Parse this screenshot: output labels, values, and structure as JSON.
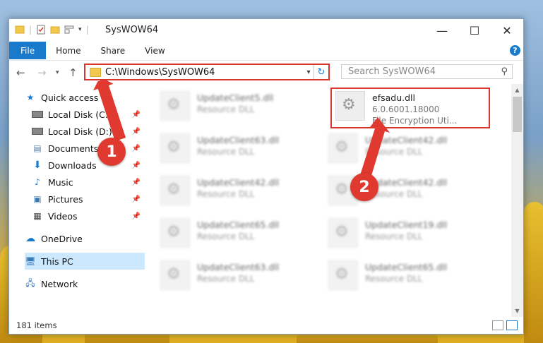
{
  "window": {
    "title": "SysWOW64",
    "controls": {
      "minimize": "—",
      "maximize": "☐",
      "close": "✕"
    }
  },
  "ribbon": {
    "tabs": [
      "File",
      "Home",
      "Share",
      "View"
    ],
    "help": "?"
  },
  "address_bar": {
    "path": "C:\\Windows\\SysWOW64",
    "dropdown_icon": "chevron-down-icon",
    "refresh_icon": "refresh-icon"
  },
  "search": {
    "placeholder": "Search SysWOW64"
  },
  "sidebar": {
    "items": [
      {
        "label": "Quick access",
        "icon": "star-icon",
        "pinned": false
      },
      {
        "label": "Local Disk (C:)",
        "icon": "drive-icon",
        "pinned": true
      },
      {
        "label": "Local Disk (D:)",
        "icon": "drive-icon",
        "pinned": true
      },
      {
        "label": "Documents",
        "icon": "documents-icon",
        "pinned": true
      },
      {
        "label": "Downloads",
        "icon": "download-icon",
        "pinned": true
      },
      {
        "label": "Music",
        "icon": "music-icon",
        "pinned": true
      },
      {
        "label": "Pictures",
        "icon": "pictures-icon",
        "pinned": true
      },
      {
        "label": "Videos",
        "icon": "videos-icon",
        "pinned": true
      },
      {
        "label": "OneDrive",
        "icon": "cloud-icon",
        "pinned": false
      },
      {
        "label": "This PC",
        "icon": "computer-icon",
        "pinned": false
      },
      {
        "label": "Network",
        "icon": "network-icon",
        "pinned": false
      }
    ]
  },
  "files": {
    "highlighted": {
      "name": "efsadu.dll",
      "version": "6.0.6001.18000",
      "description": "File Encryption Uti..."
    },
    "left_column": [
      {
        "name": "UpdateClient5.dll",
        "type": "Resource DLL"
      },
      {
        "name": "UpdateClient63.dll",
        "type": "Resource DLL"
      },
      {
        "name": "UpdateClient42.dll",
        "type": "Resource DLL"
      },
      {
        "name": "UpdateClient65.dll",
        "type": "Resource DLL"
      },
      {
        "name": "UpdateClient63.dll",
        "type": "Resource DLL"
      }
    ],
    "right_column": [
      {
        "name": "UpdateClient42.dll",
        "type": "Resource DLL"
      },
      {
        "name": "UpdateClient42.dll",
        "type": "Resource DLL"
      },
      {
        "name": "UpdateClient19.dll",
        "type": "Resource DLL"
      },
      {
        "name": "UpdateClient65.dll",
        "type": "Resource DLL"
      }
    ]
  },
  "status": {
    "item_count": "181 items"
  },
  "annotations": {
    "step1": "1",
    "step2": "2",
    "color": "#d9362e"
  }
}
